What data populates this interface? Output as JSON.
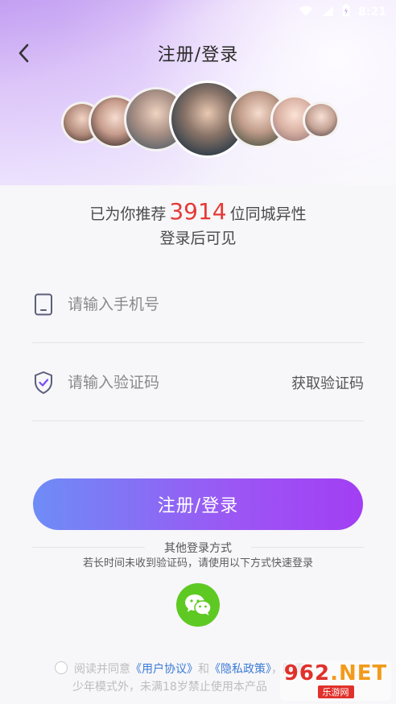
{
  "status_bar": {
    "time": "8:21"
  },
  "header": {
    "title": "注册/登录"
  },
  "recommend": {
    "prefix": "已为你推荐",
    "count": "3914",
    "suffix": "位同城异性",
    "line2": "登录后可见"
  },
  "phone_field": {
    "placeholder": "请输入手机号"
  },
  "code_field": {
    "placeholder": "请输入验证码",
    "get_code_label": "获取验证码"
  },
  "login_button": {
    "label": "注册/登录"
  },
  "other_login": {
    "title": "其他登录方式",
    "hint": "若长时间未收到验证码，请使用以下方式快速登录"
  },
  "agreement": {
    "text1": "阅读并同意",
    "user_agreement": "《用户协议》",
    "and": "和",
    "privacy_policy": "《隐私政策》",
    "text2": "，除青",
    "line2": "少年模式外，未满18岁禁止使用本产品"
  },
  "watermark": {
    "main": "962",
    "net": ".NET",
    "sub": "乐游网"
  },
  "colors": {
    "accent_start": "#6e8cf6",
    "accent_end": "#a23ef3",
    "highlight": "#e53935",
    "wechat_green": "#5ec923",
    "link": "#3a7bd5"
  },
  "icons": {
    "back": "chevron-left-icon",
    "phone": "phone-icon",
    "shield": "shield-check-icon",
    "wechat": "wechat-icon",
    "wifi": "wifi-icon",
    "signal": "signal-icon",
    "battery": "battery-icon"
  }
}
